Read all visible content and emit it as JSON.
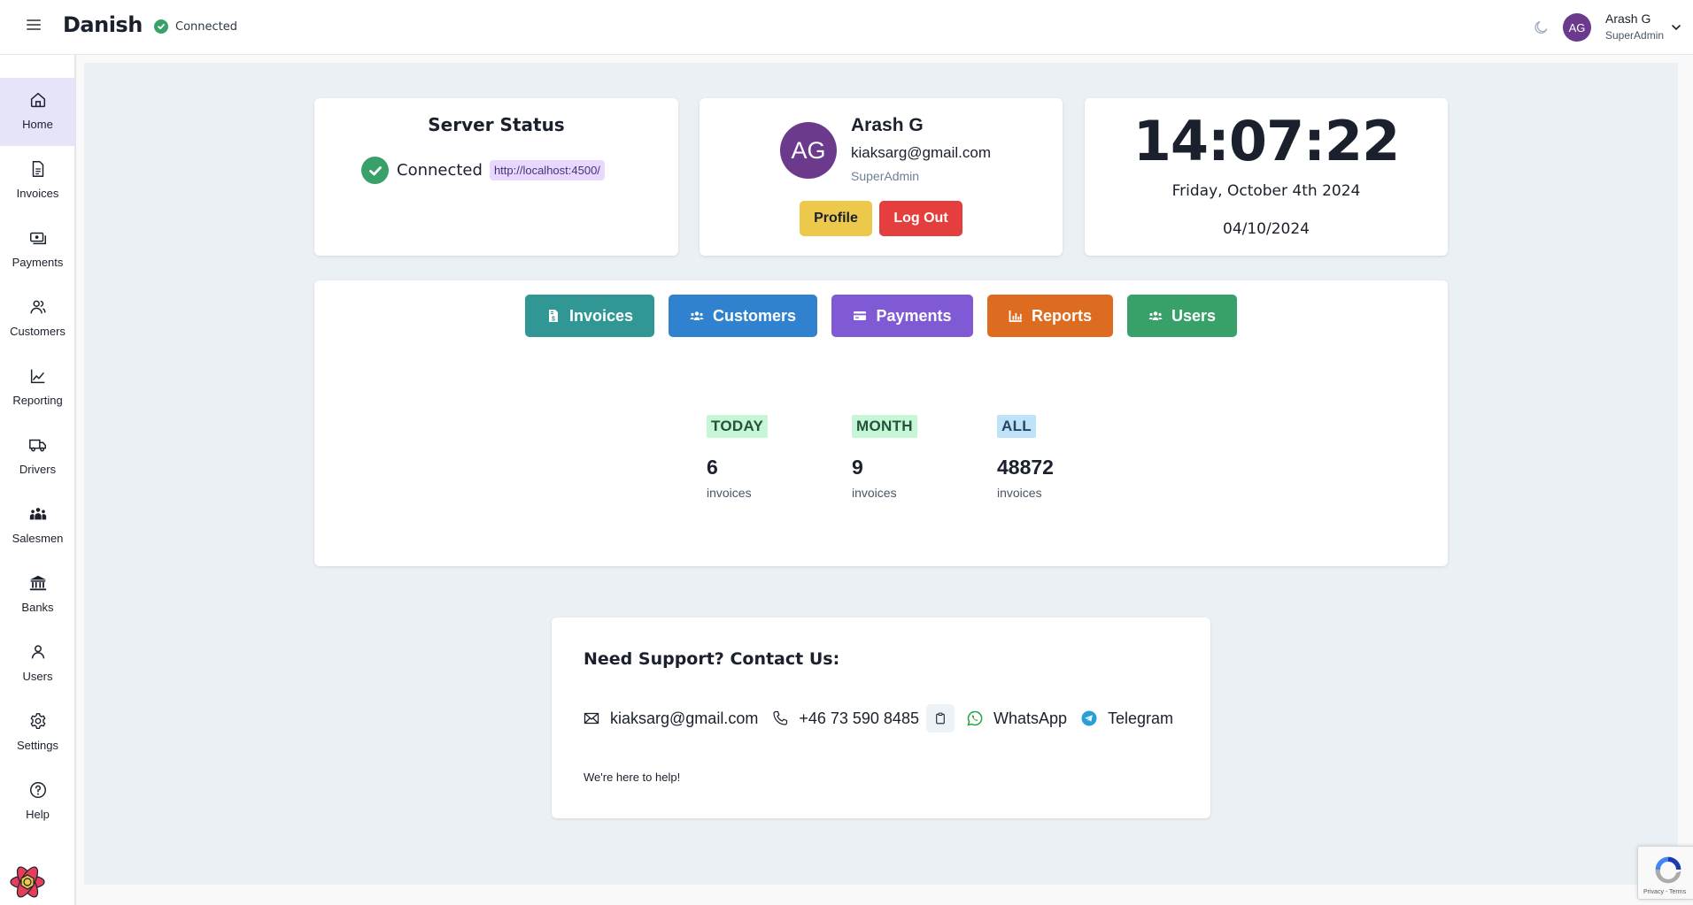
{
  "header": {
    "app_title": "Danish",
    "connection_status": "Connected",
    "user_initials": "AG",
    "user_name": "Arash G",
    "user_role": "SuperAdmin"
  },
  "sidebar": {
    "items": [
      {
        "label": "Home",
        "icon": "home-icon",
        "active": true
      },
      {
        "label": "Invoices",
        "icon": "document-icon"
      },
      {
        "label": "Payments",
        "icon": "cash-icon"
      },
      {
        "label": "Customers",
        "icon": "users-icon"
      },
      {
        "label": "Reporting",
        "icon": "chart-line-icon"
      },
      {
        "label": "Drivers",
        "icon": "truck-icon"
      },
      {
        "label": "Salesmen",
        "icon": "people-group-icon"
      },
      {
        "label": "Banks",
        "icon": "bank-icon"
      },
      {
        "label": "Users",
        "icon": "user-icon"
      },
      {
        "label": "Settings",
        "icon": "gear-icon"
      },
      {
        "label": "Help",
        "icon": "help-icon"
      }
    ]
  },
  "server_status": {
    "title": "Server Status",
    "status": "Connected",
    "url": "http://localhost:4500/"
  },
  "profile": {
    "initials": "AG",
    "name": "Arash G",
    "email": "kiaksarg@gmail.com",
    "role": "SuperAdmin",
    "profile_button": "Profile",
    "logout_button": "Log Out"
  },
  "clock": {
    "time": "14:07:22",
    "long_date": "Friday, October 4th 2024",
    "short_date": "04/10/2024"
  },
  "quick_actions": [
    {
      "label": "Invoices",
      "color": "#319795",
      "icon": "file-invoice-dollar-icon"
    },
    {
      "label": "Customers",
      "color": "#3182ce",
      "icon": "users-icon"
    },
    {
      "label": "Payments",
      "color": "#805ad5",
      "icon": "credit-card-icon"
    },
    {
      "label": "Reports",
      "color": "#dd6b20",
      "icon": "chart-bar-icon"
    },
    {
      "label": "Users",
      "color": "#38a169",
      "icon": "users-icon"
    }
  ],
  "stats": [
    {
      "label": "TODAY",
      "value": "6",
      "unit": "invoices"
    },
    {
      "label": "MONTH",
      "value": "9",
      "unit": "invoices"
    },
    {
      "label": "ALL",
      "value": "48872",
      "unit": "invoices"
    }
  ],
  "support": {
    "title": "Need Support? Contact Us:",
    "email": "kiaksarg@gmail.com",
    "phone": "+46 73 590 8485",
    "whatsapp": "WhatsApp",
    "telegram": "Telegram",
    "footer": "We're here to help!"
  },
  "recaptcha": {
    "links": "Privacy - Terms"
  }
}
